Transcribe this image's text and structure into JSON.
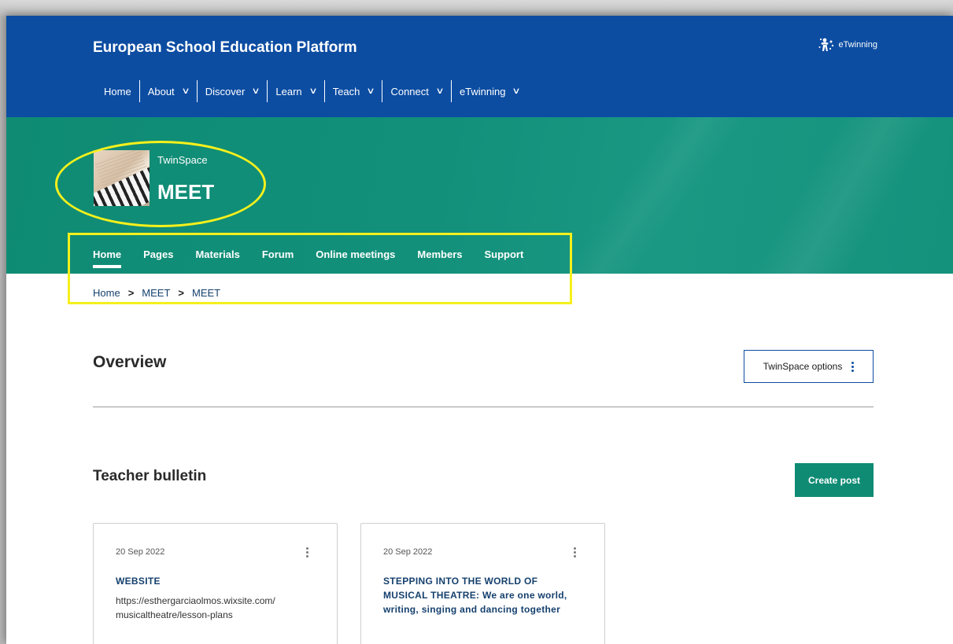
{
  "header": {
    "site_title": "European School Education Platform",
    "brand_label": "eTwinning",
    "nav": [
      {
        "label": "Home",
        "has_dropdown": false
      },
      {
        "label": "About",
        "has_dropdown": true
      },
      {
        "label": "Discover",
        "has_dropdown": true
      },
      {
        "label": "Learn",
        "has_dropdown": true
      },
      {
        "label": "Teach",
        "has_dropdown": true
      },
      {
        "label": "Connect",
        "has_dropdown": true
      },
      {
        "label": "eTwinning",
        "has_dropdown": true
      }
    ],
    "chevron": "⌄"
  },
  "hero": {
    "space_label": "TwinSpace",
    "project_title": "MEET",
    "tabs": [
      {
        "label": "Home",
        "active": true
      },
      {
        "label": "Pages",
        "active": false
      },
      {
        "label": "Materials",
        "active": false
      },
      {
        "label": "Forum",
        "active": false
      },
      {
        "label": "Online meetings",
        "active": false
      },
      {
        "label": "Members",
        "active": false
      },
      {
        "label": "Support",
        "active": false
      }
    ]
  },
  "breadcrumb": {
    "items": [
      "Home",
      "MEET",
      "MEET"
    ],
    "separator": ">"
  },
  "overview": {
    "title": "Overview",
    "options_label": "TwinSpace options"
  },
  "bulletin": {
    "title": "Teacher bulletin",
    "create_label": "Create post",
    "posts": [
      {
        "date": "20 Sep 2022",
        "title": "WEBSITE",
        "body": "https://esthergarciaolmos.wixsite.com/ musicaltheatre/lesson-plans"
      },
      {
        "date": "20 Sep 2022",
        "title": "STEPPING INTO THE WORLD OF MUSICAL THEATRE: We are one world, writing, singing and dancing together",
        "body": ""
      }
    ]
  },
  "colors": {
    "header_blue": "#0c4da2",
    "hero_teal": "#0f8b74",
    "annotation_yellow": "#f5f01c"
  }
}
